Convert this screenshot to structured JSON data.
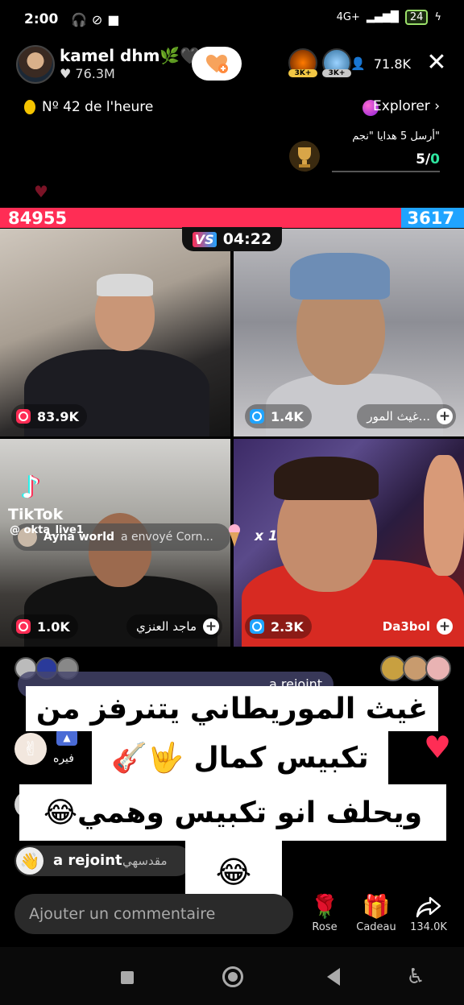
{
  "status_bar": {
    "time": "2:00",
    "network": "4G+",
    "battery": "24"
  },
  "host": {
    "name": "kamel dhm🌿🖤",
    "likes": "♥ 76.3M"
  },
  "viewers": {
    "badge_1": "3K+",
    "badge_2": "3K+",
    "count": "71.8K"
  },
  "rank": {
    "text": "Nº 42 de l'heure"
  },
  "explorer": {
    "label": "Explorer ›"
  },
  "goal": {
    "text": "أرسل 5 هدايا \"نجم\"",
    "progress": "5/0"
  },
  "battle": {
    "score_left": "84955",
    "score_right": "3617",
    "timer": "04:22",
    "vs_label": "VS"
  },
  "cells": [
    {
      "count": "83.9K",
      "name": ""
    },
    {
      "count": "1.4K",
      "name": "غيث المور..."
    },
    {
      "count": "1.0K",
      "name": "ماجد العنزي"
    },
    {
      "count": "2.3K",
      "name": "Da3bol"
    }
  ],
  "watermark": {
    "wordmark": "TikTok",
    "handle": "@ okta_live1"
  },
  "gift_banner": {
    "sender": "Ayna world",
    "action": "a envoyé  Corn...",
    "multiplier": "x 1"
  },
  "chat": {
    "top_join": "a rejoint",
    "user_1": "فيره",
    "join_label": "a rejoint",
    "join_user": "مقدسهي"
  },
  "caption": {
    "line_1": "غيث الموريطاني يتنرفز من",
    "line_2": "تكبيس كمال 🤟🎸",
    "line_3": "ويحلف انو تكبيس وهمي😂",
    "line_4": "😂"
  },
  "comment": {
    "placeholder": "Ajouter un commentaire"
  },
  "actions": {
    "rose_label": "Rose",
    "gift_label": "Cadeau",
    "share_count": "134.0K"
  },
  "colors": {
    "battle_red": "#ff2d55",
    "battle_blue": "#20a4ff"
  }
}
